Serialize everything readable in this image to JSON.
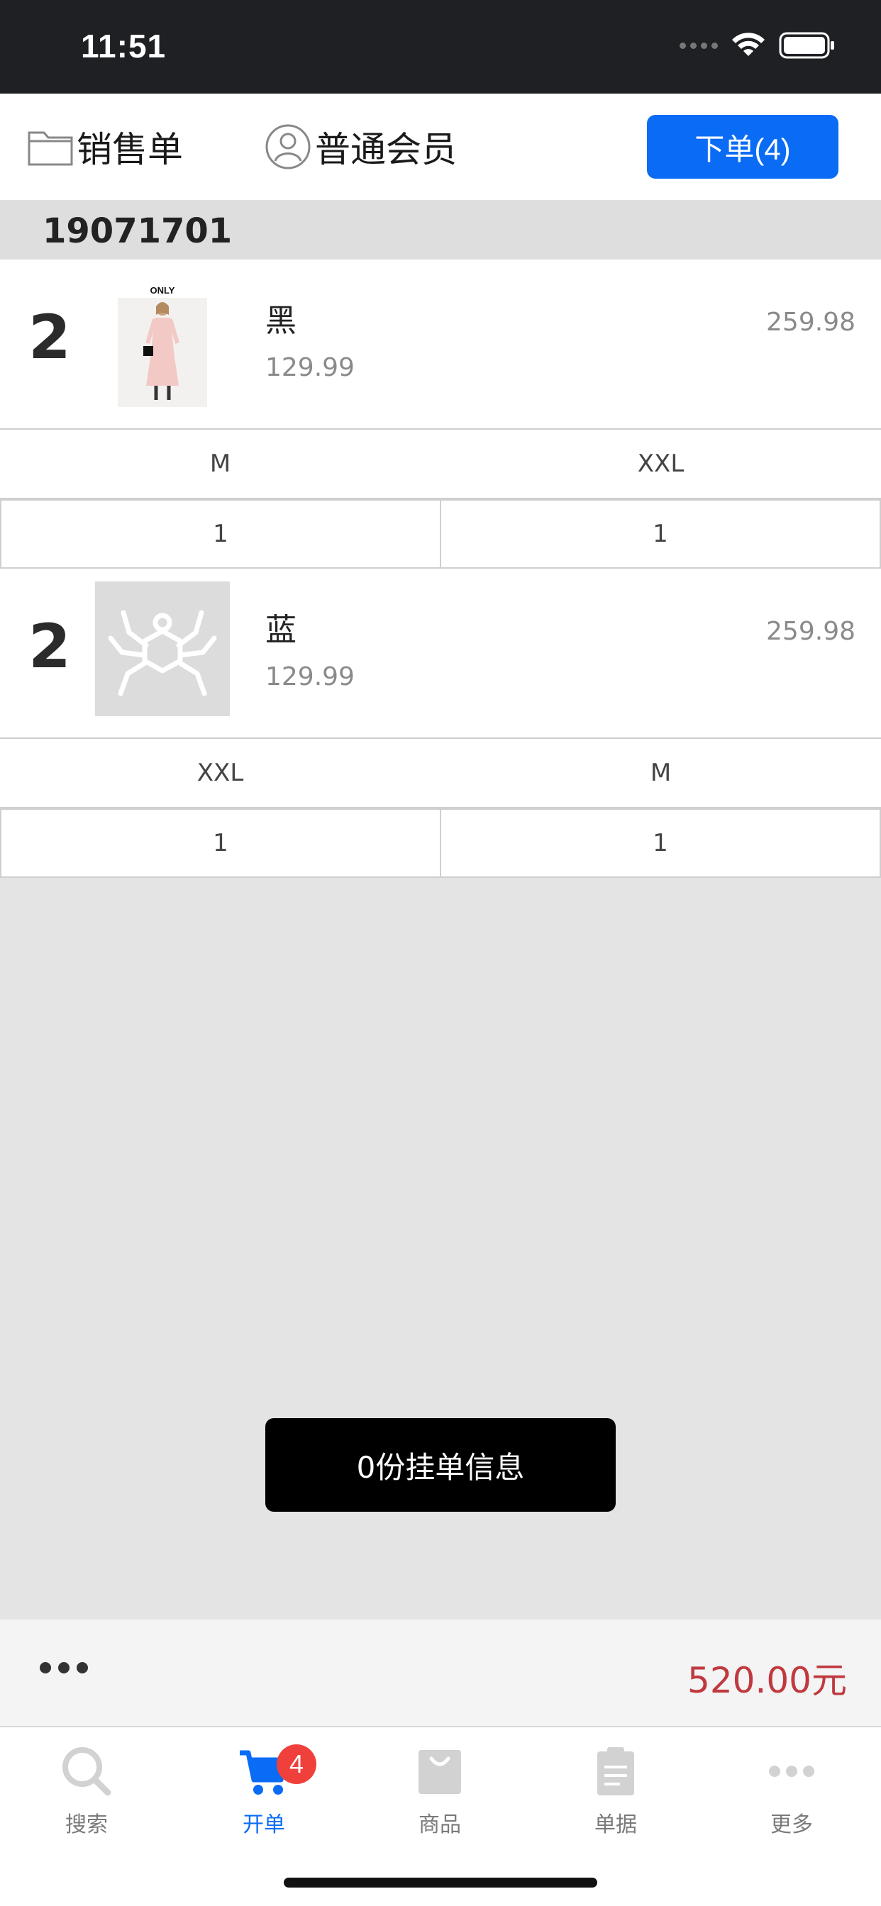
{
  "status_bar": {
    "time": "11:51"
  },
  "header": {
    "sales_label": "销售单",
    "member_label": "普通会员",
    "order_button": "下单(4)"
  },
  "order_number": "19071701",
  "items": [
    {
      "quantity": "2",
      "image": "brand-only-dress-photo",
      "brand_text": "ONLY",
      "color": "黑",
      "unit_price": "129.99",
      "line_total": "259.98",
      "sizes": [
        {
          "size": "M",
          "qty": "1"
        },
        {
          "size": "XXL",
          "qty": "1"
        }
      ]
    },
    {
      "quantity": "2",
      "image": "spider-placeholder-icon",
      "color": "蓝",
      "unit_price": "129.99",
      "line_total": "259.98",
      "sizes": [
        {
          "size": "XXL",
          "qty": "1"
        },
        {
          "size": "M",
          "qty": "1"
        }
      ]
    }
  ],
  "toast": "0份挂单信息",
  "total": "520.00元",
  "tabs": [
    {
      "label": "搜索",
      "icon": "search-icon",
      "active": false
    },
    {
      "label": "开单",
      "icon": "cart-icon",
      "active": true,
      "badge": "4"
    },
    {
      "label": "商品",
      "icon": "bag-icon",
      "active": false
    },
    {
      "label": "单据",
      "icon": "clipboard-icon",
      "active": false
    },
    {
      "label": "更多",
      "icon": "more-icon",
      "active": false
    }
  ],
  "colors": {
    "accent": "#0a6cf5",
    "total": "#c0393f",
    "badge": "#f0403c",
    "status_bar": "#1f2024"
  }
}
